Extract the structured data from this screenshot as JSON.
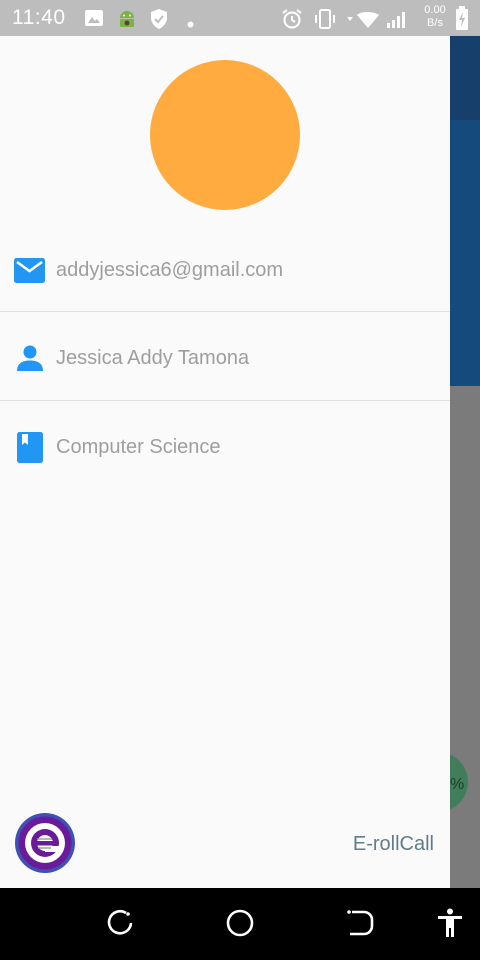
{
  "status_bar": {
    "time": "11:40",
    "net_speed_value": "0.00",
    "net_speed_unit": "B/s",
    "icons": [
      "image-icon",
      "android-icon",
      "shield-icon",
      "dot-icon",
      "alarm-icon",
      "vibrate-icon",
      "wifi-icon",
      "signal-icon",
      "battery-charging-icon"
    ]
  },
  "drawer": {
    "avatar_color": "#ffab40",
    "email": "addyjessica6@gmail.com",
    "name": "Jessica Addy Tamona",
    "department": "Computer Science",
    "app_name": "E-rollCall",
    "accent_color": "#2196f3"
  },
  "background_app": {
    "appbar_color": "#16406b",
    "header_color": "#144a7c",
    "fab_text": "%"
  },
  "nav_bar": {
    "buttons": [
      "recents-icon",
      "home-icon",
      "back-icon",
      "accessibility-icon"
    ]
  }
}
